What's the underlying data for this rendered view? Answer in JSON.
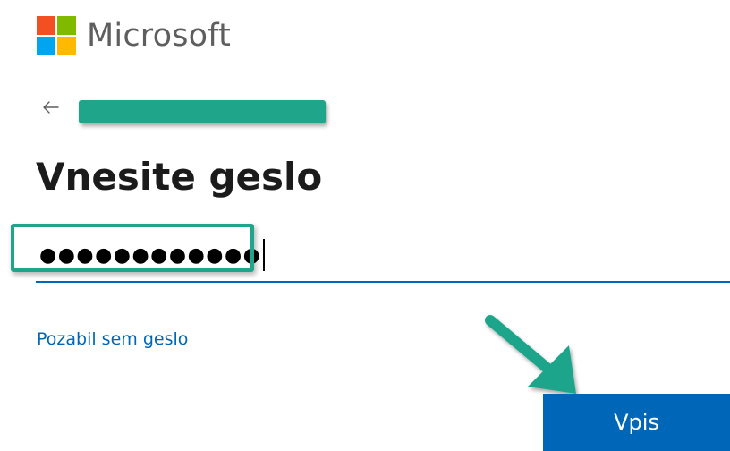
{
  "brand": {
    "name": "Microsoft",
    "logo_colors": [
      "#f25022",
      "#7fba00",
      "#00a4ef",
      "#ffb900"
    ]
  },
  "header": {
    "back_icon": "arrow-left-icon"
  },
  "identity": {
    "redaction_color": "#1fa58a"
  },
  "main": {
    "title": "Vnesite geslo",
    "password_value": "●●●●●●●●●●●●",
    "forgot_link": "Pozabil sem geslo",
    "signin_label": "Vpis"
  },
  "annotations": {
    "highlight_color": "#1fa58a",
    "arrow_color": "#1fa58a"
  },
  "colors": {
    "accent": "#0067b8",
    "title": "#1b1b1b",
    "brand_text": "#5e5e5e"
  }
}
